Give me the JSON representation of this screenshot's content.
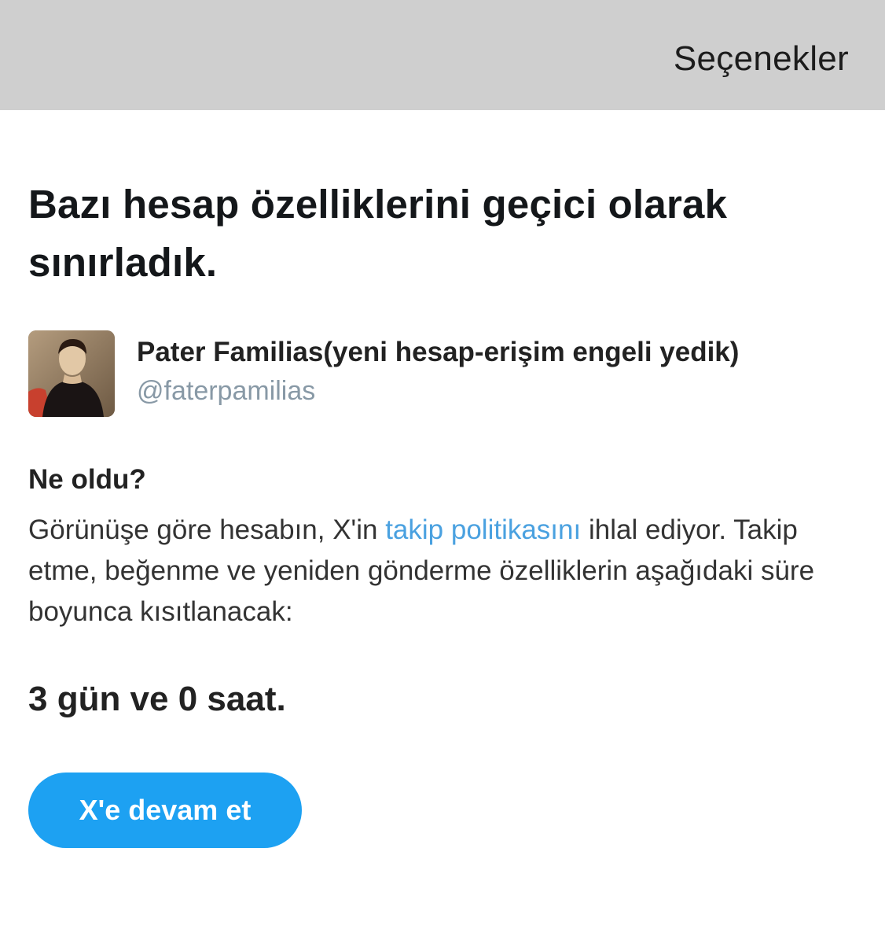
{
  "header": {
    "options_label": "Seçenekler",
    "background_color": "#cfcfcf"
  },
  "notice": {
    "headline": "Bazı hesap özelliklerini geçici olarak sınırladık."
  },
  "account": {
    "display_name": "Pater Familias(yeni hesap-erişim engeli yedik)",
    "handle": "@faterpamilias",
    "avatar_icon": "profile-portrait-avatar"
  },
  "details": {
    "section_title": "Ne oldu?",
    "body_before_link": "Görünüşe göre hesabın, X'in ",
    "link_text": "takip politikasını",
    "body_after_link": " ihlal ediyor. Takip etme, beğenme ve yeniden gönderme özelliklerin aşağıdaki süre boyunca kısıtlanacak:",
    "link_color": "#4aa1e0"
  },
  "restriction": {
    "duration": "3 gün ve 0 saat."
  },
  "actions": {
    "continue_label": "X'e devam et",
    "continue_color": "#1da1f2"
  }
}
